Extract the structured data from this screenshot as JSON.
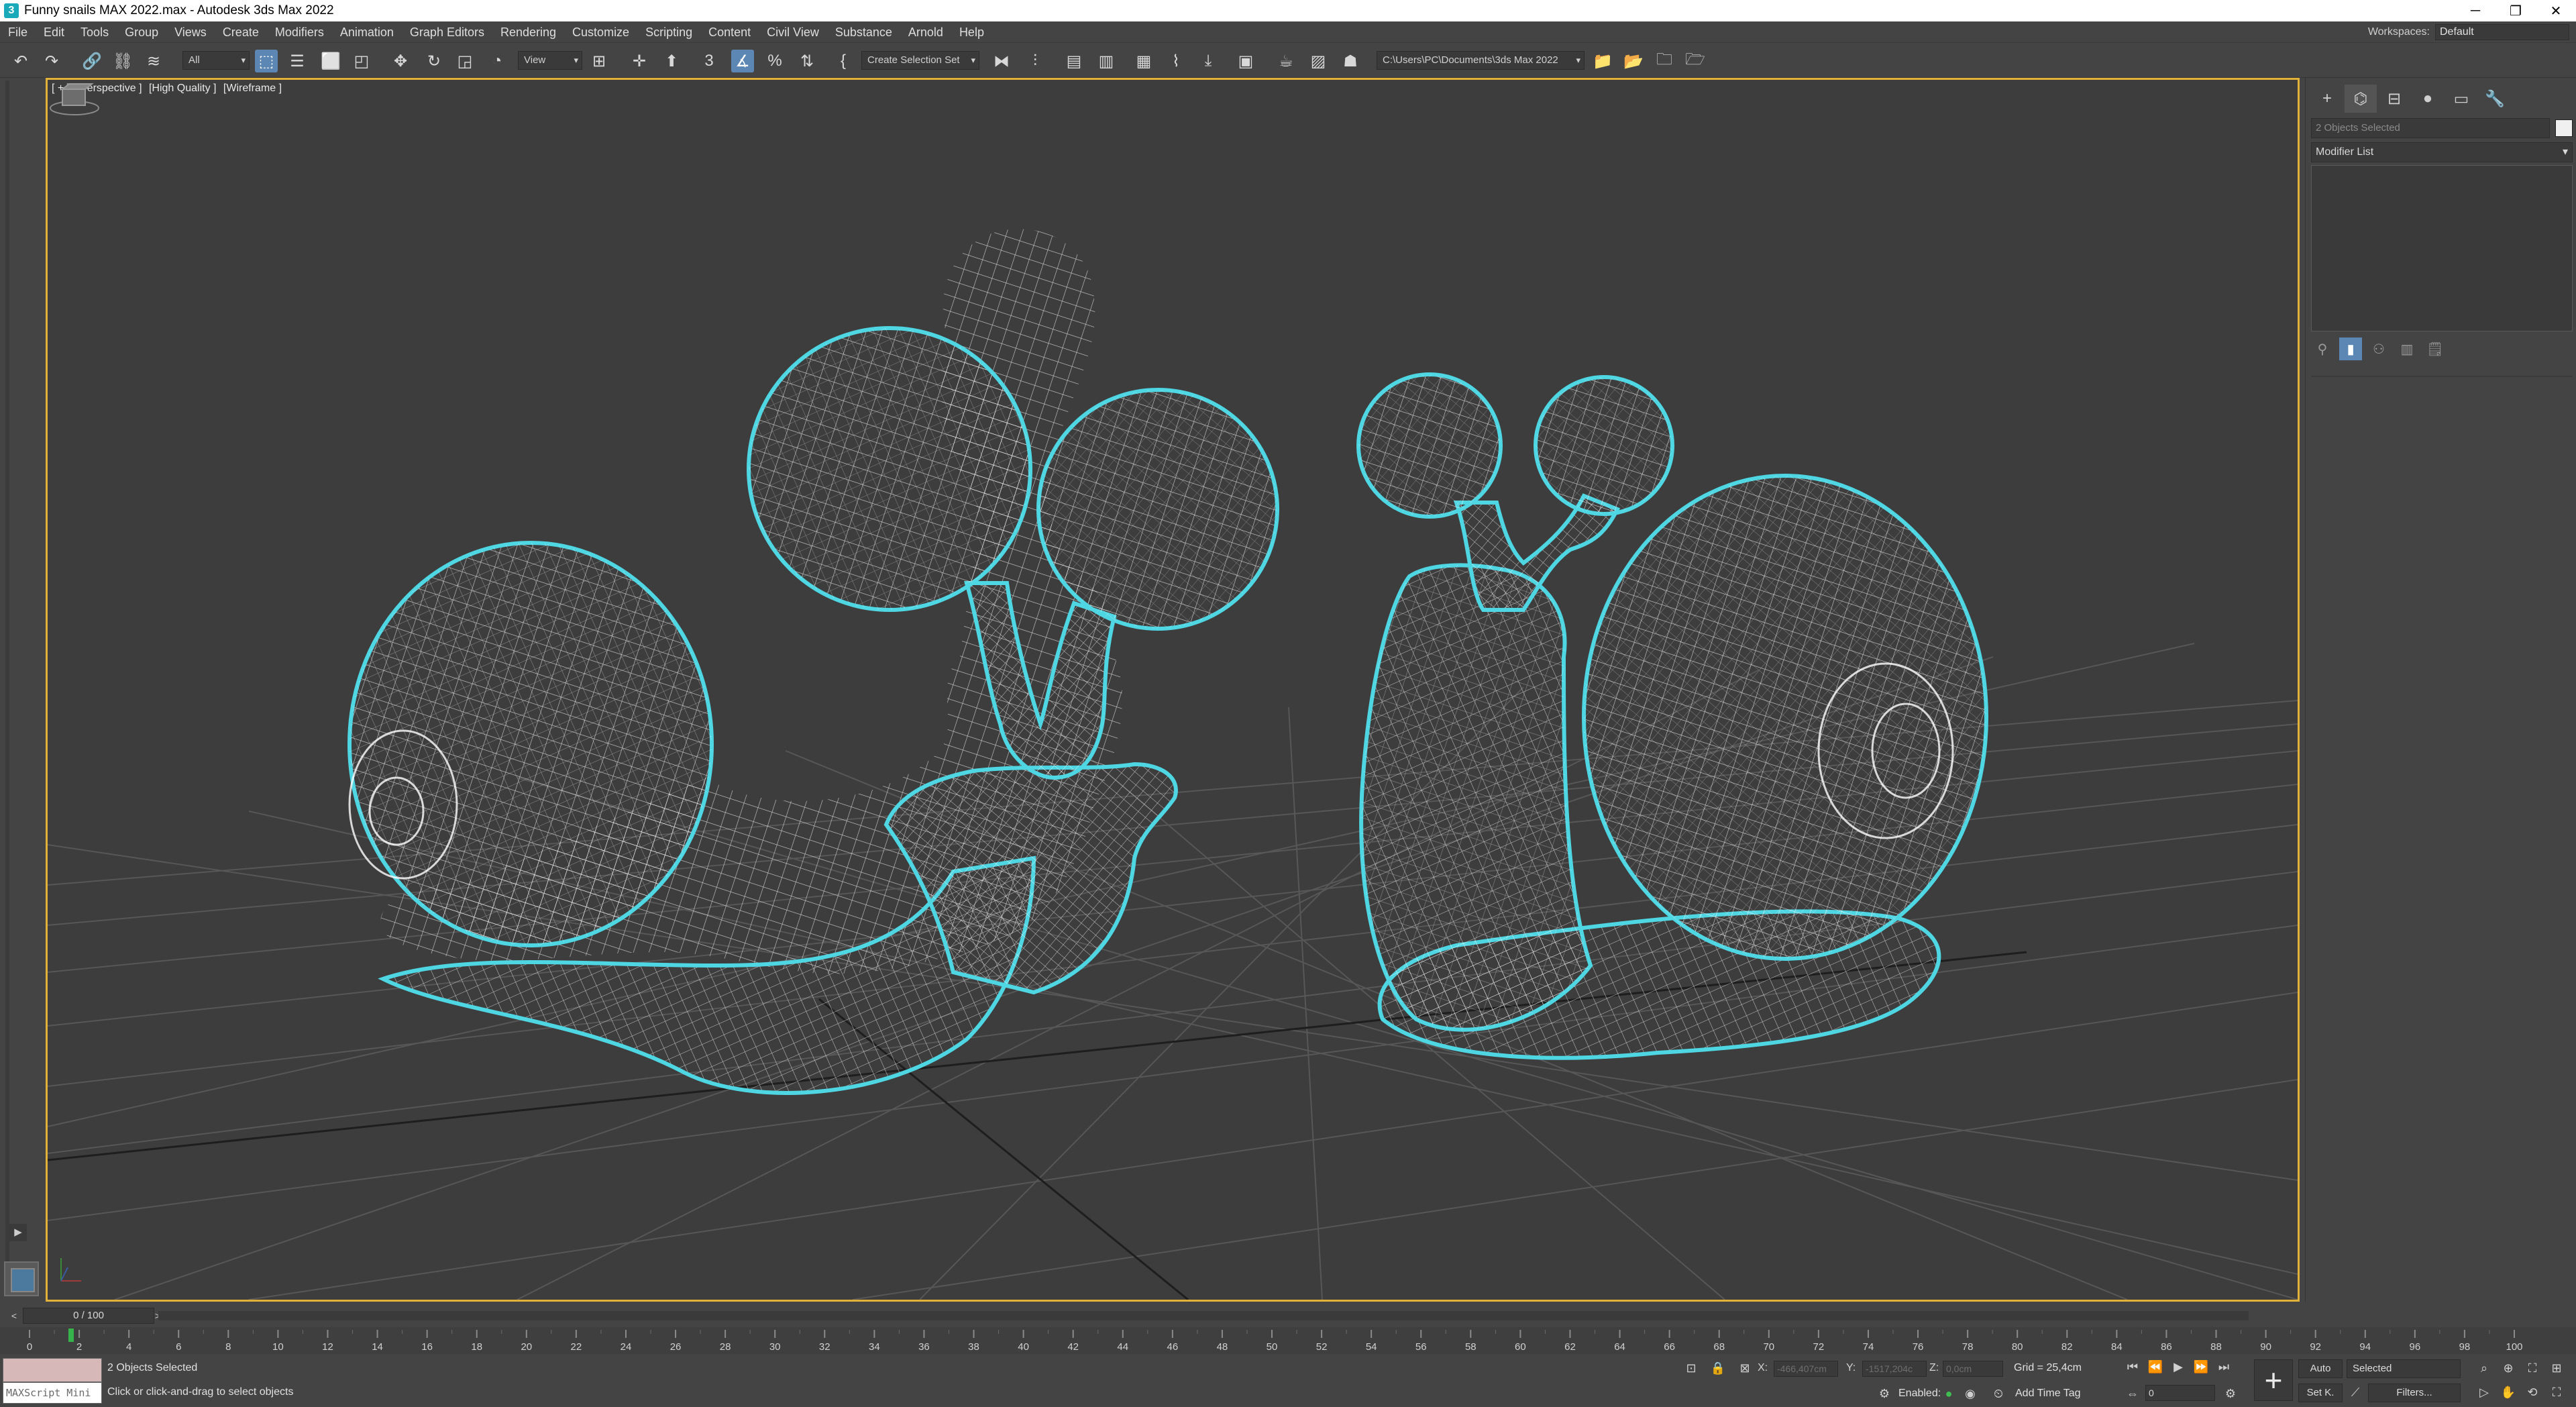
{
  "window": {
    "title": "Funny snails MAX 2022.max - Autodesk 3ds Max 2022",
    "minimize": "─",
    "restore": "❐",
    "close": "✕"
  },
  "menu": {
    "items": [
      "File",
      "Edit",
      "Tools",
      "Group",
      "Views",
      "Create",
      "Modifiers",
      "Animation",
      "Graph Editors",
      "Rendering",
      "Customize",
      "Scripting",
      "Content",
      "Civil View",
      "Substance",
      "Arnold",
      "Help"
    ],
    "workspaces_label": "Workspaces:",
    "workspaces_value": "Default"
  },
  "toolbar": {
    "selection_filter": "All",
    "reference_coord": "View",
    "named_selection": "Create Selection Set",
    "project_path": "C:\\Users\\PC\\Documents\\3ds Max 2022",
    "snap_label": "3"
  },
  "viewport": {
    "label_plus": "[ + ]",
    "label_view": "[Perspective ]",
    "label_quality": "[High Quality ]",
    "label_mode": "[Wireframe ]",
    "selection_color": "#4fd6e3",
    "wire_color": "#ffffff",
    "active_border": "#e0b23a"
  },
  "command_panel": {
    "selection_field": "2 Objects Selected",
    "modifier_list": "Modifier List"
  },
  "time": {
    "frame_display": "0 / 100",
    "ticks": [
      "0",
      "2",
      "4",
      "6",
      "8",
      "10",
      "12",
      "14",
      "16",
      "18",
      "20",
      "22",
      "24",
      "26",
      "28",
      "30",
      "32",
      "34",
      "36",
      "38",
      "40",
      "42",
      "44",
      "46",
      "48",
      "50",
      "52",
      "54",
      "56",
      "58",
      "60",
      "62",
      "64",
      "66",
      "68",
      "70",
      "72",
      "74",
      "76",
      "78",
      "80",
      "82",
      "84",
      "86",
      "88",
      "90",
      "92",
      "94",
      "96",
      "98",
      "100"
    ]
  },
  "status": {
    "maxscript": "MAXScript Mini",
    "selected": "2 Objects Selected",
    "prompt": "Click or click-and-drag to select objects",
    "x_label": "X:",
    "x_value": "-466,407cm",
    "y_label": "Y:",
    "y_value": "-1517,204c",
    "z_label": "Z:",
    "z_value": "0,0cm",
    "grid": "Grid = 25,4cm",
    "enabled": "Enabled:",
    "add_time_tag": "Add Time Tag",
    "auto": "Auto",
    "set_key": "Set K.",
    "key_filter": "Selected",
    "filters": "Filters...",
    "current_frame": "0"
  }
}
